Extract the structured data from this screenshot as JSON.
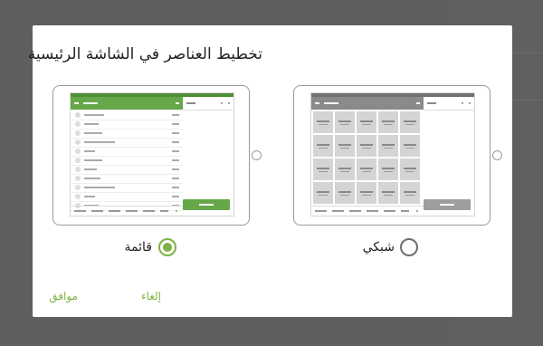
{
  "dialog": {
    "title": "تخطيط العناصر في الشاشة الرئيسية",
    "options": [
      {
        "label": "قائمة",
        "selected": true
      },
      {
        "label": "شبكي",
        "selected": false
      }
    ],
    "actions": {
      "ok": "موافق",
      "cancel": "إلغاء"
    }
  },
  "colors": {
    "accent": "#7cb342",
    "list_appbar": "#66a74a",
    "list_statusbar": "#4e8f35",
    "grid_appbar": "#8a8a8a",
    "grid_statusbar": "#707070",
    "grid_button": "#9e9e9e"
  }
}
